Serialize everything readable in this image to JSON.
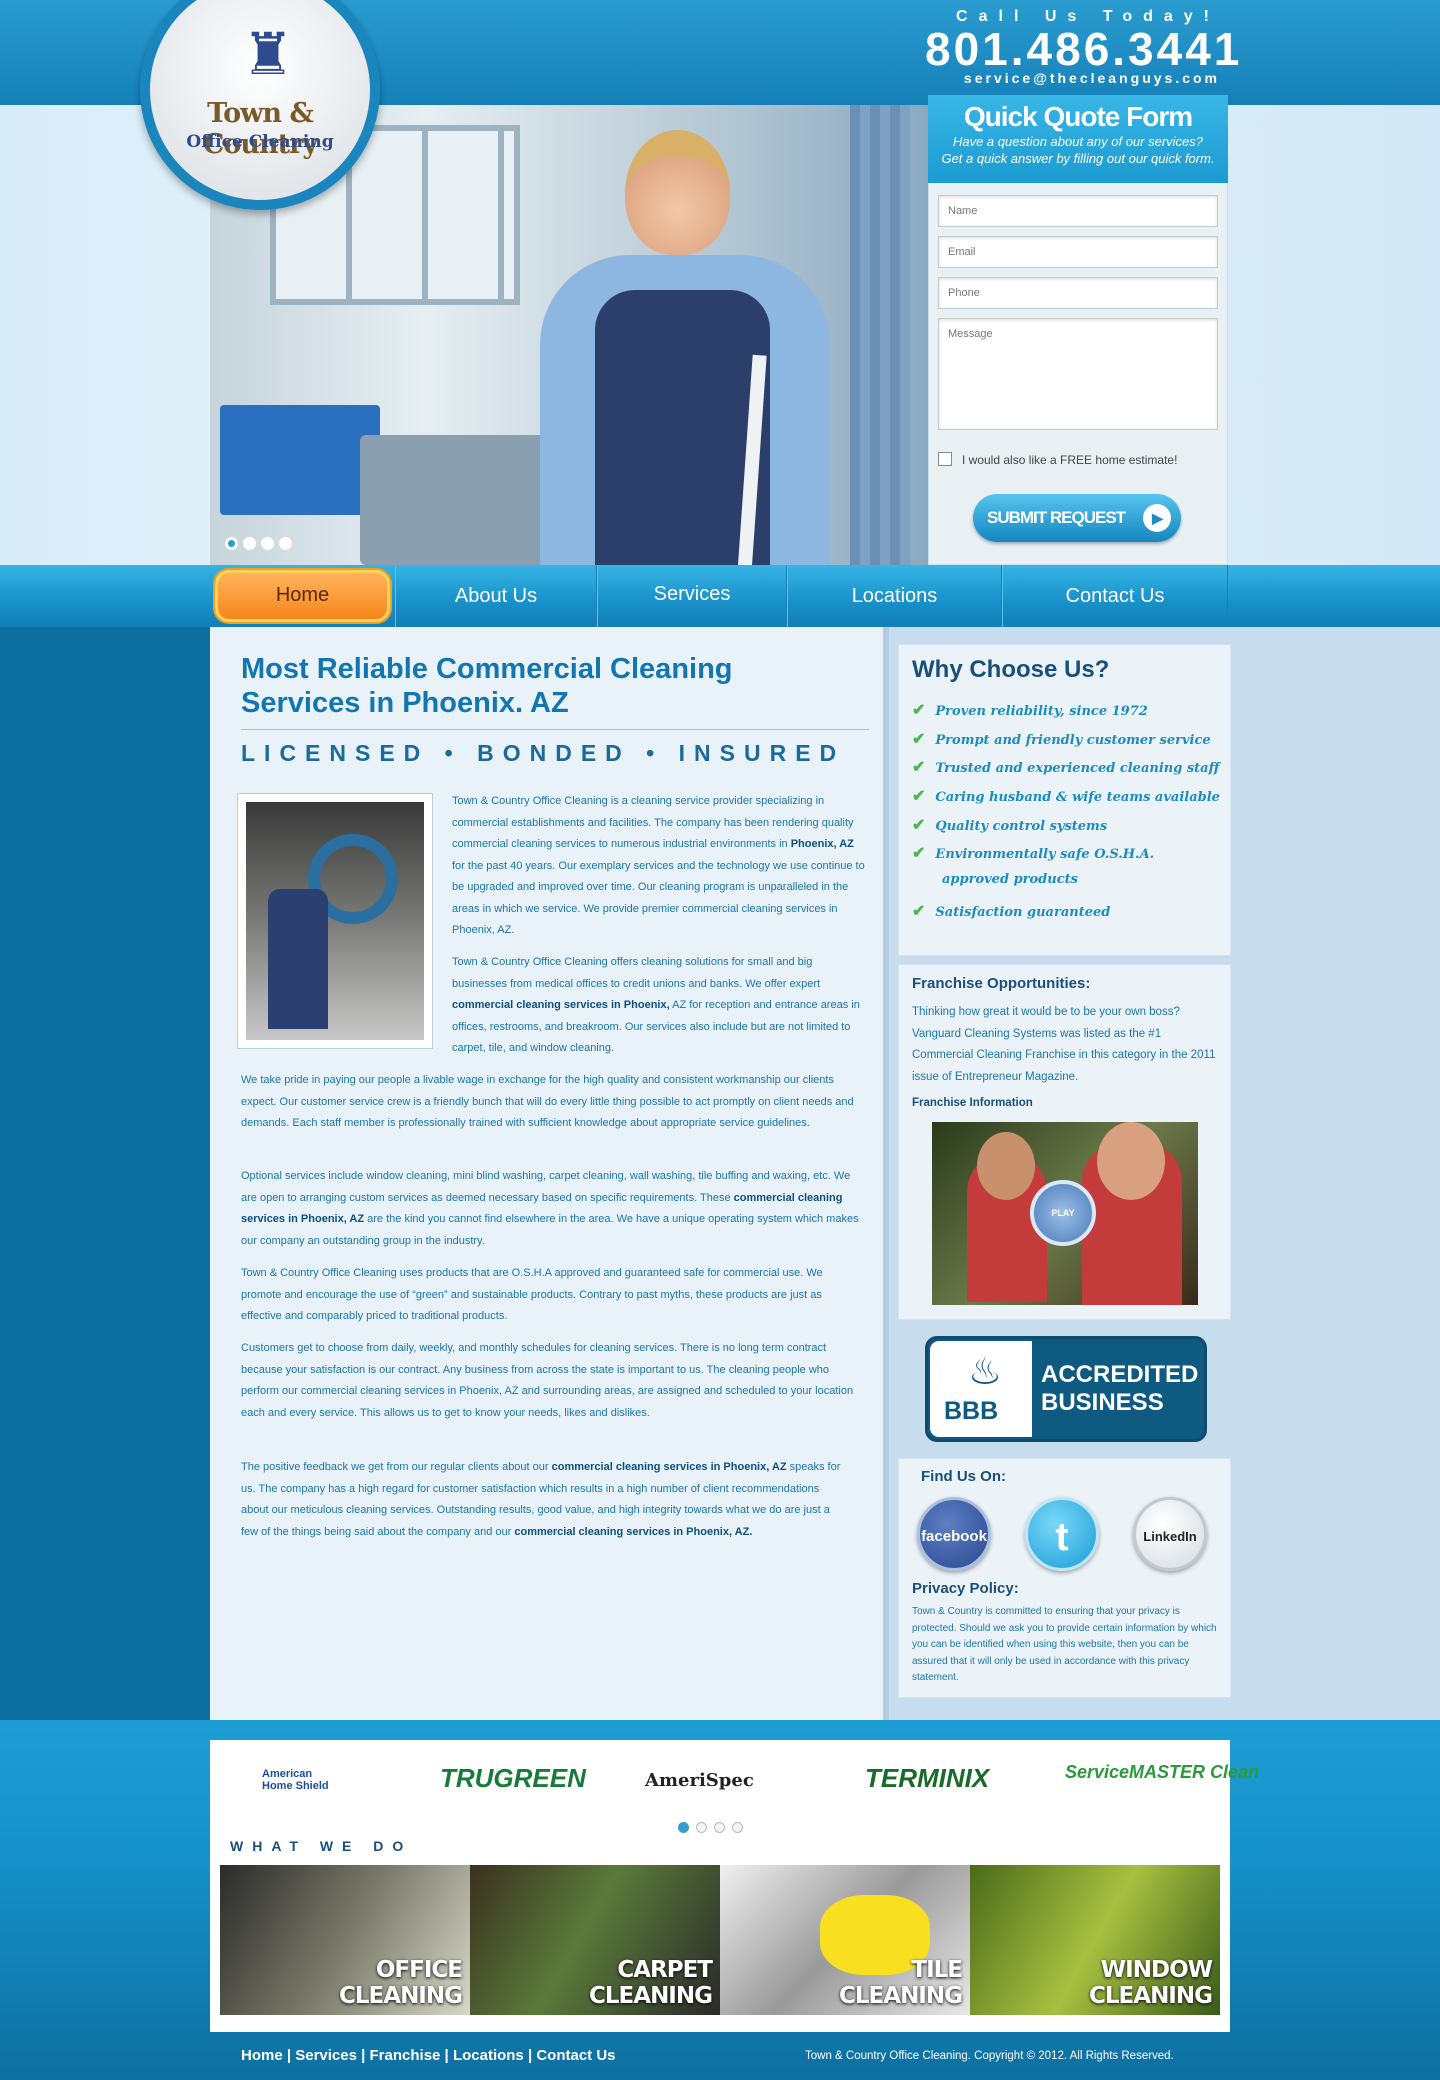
{
  "header": {
    "call_label": "Call Us Today!",
    "phone": "801.486.3441",
    "email": "service@thecleanguys.com",
    "logo_line1": "Town & Country",
    "logo_line2": "Office Cleaning"
  },
  "quote_form": {
    "title": "Quick Quote Form",
    "subtitle1": "Have a question about any of our services?",
    "subtitle2": "Get a quick answer by filling out our quick form.",
    "name_placeholder": "Name",
    "email_placeholder": "Email",
    "phone_placeholder": "Phone",
    "message_placeholder": "Message",
    "checkbox_label": "I would also like a FREE home estimate!",
    "submit_label": "SUBMIT REQUEST"
  },
  "nav": {
    "items": [
      "Home",
      "About Us",
      "Services",
      "Locations",
      "Contact Us"
    ]
  },
  "main": {
    "title": "Most Reliable Commercial Cleaning Services in Phoenix. AZ",
    "tagline": "LICENSED • BONDED • INSURED",
    "p1a": "Town & Country Office Cleaning is a cleaning service provider specializing in commercial establishments and facilities. The company has been rendering quality commercial cleaning services to numerous industrial environments in ",
    "p1b": "Phoenix, AZ",
    "p1c": " for the past 40 years. Our exemplary services and the technology we use continue to be upgraded and improved over time. Our cleaning program is unparalleled in the areas in which we service. We provide premier commercial cleaning services in Phoenix, AZ.",
    "p2a": "Town & Country Office Cleaning offers cleaning solutions for small and big businesses from medical offices to credit unions and banks. We offer expert ",
    "p2b": "commercial cleaning services in Phoenix,",
    "p2c": " AZ for reception and entrance areas in offices, restrooms, and breakroom. Our services also include but are not limited to carpet, tile, and window cleaning.",
    "p3": "We take pride in paying our people a livable wage in exchange for the high quality and consistent workmanship our clients expect. Our customer service crew is a friendly bunch that will do every little thing possible to act promptly on client needs and demands. Each staff member is professionally trained with sufficient knowledge about appropriate service guidelines.",
    "p4a": "Optional services include window cleaning, mini blind washing, carpet cleaning, wall washing, tile buffing and waxing, etc. We are open to arranging custom services as deemed necessary based on specific requirements. These ",
    "p4b": "commercial cleaning services in Phoenix, AZ",
    "p4c": " are the kind you cannot find elsewhere in the area. We have a unique operating system which makes our company an outstanding group in the industry.",
    "p5": "Town & Country Office Cleaning uses products that are O.S.H.A approved and guaranteed safe for commercial use. We promote and encourage the use of “green” and sustainable products. Contrary to past myths, these products are just as effective and comparably priced to traditional products.",
    "p6": "Customers get to choose from daily, weekly, and monthly schedules for cleaning services. There is no long term contract because your satisfaction is our contract. Any business from across the state is important to us. The cleaning people who perform our commercial cleaning services in Phoenix, AZ and surrounding areas, are assigned and scheduled to your location each and every service. This allows us to get to know your needs, likes and dislikes.",
    "p7a": "The positive feedback we get from our regular clients about our ",
    "p7b": "commercial cleaning services in Phoenix, AZ",
    "p7c": " speaks for us. The company has a high regard for customer satisfaction which results in a high number of client recommendations about our meticulous cleaning services. Outstanding results, good value, and high integrity towards what we do are just a few of the things being said about the company and our ",
    "p7d": "commercial cleaning services in Phoenix, AZ."
  },
  "why": {
    "title": "Why Choose Us?",
    "items": [
      "Proven reliability, since 1972",
      "Prompt and friendly customer service",
      "Trusted and experienced cleaning staff",
      "Caring husband & wife teams available",
      "Quality control systems",
      "Environmentally safe O.S.H.A.",
      "approved products",
      "Satisfaction guaranteed"
    ]
  },
  "franchise": {
    "title": "Franchise Opportunities:",
    "text": "Thinking how great it would be to be your own boss? Vanguard Cleaning Systems was listed as the #1 Commercial Cleaning Franchise in this category in the 2011 issue of Entrepreneur Magazine.",
    "info_label": "Franchise Information",
    "play_label": "PLAY"
  },
  "bbb": {
    "line1": "ACCREDITED",
    "line2": "BUSINESS",
    "logo": "BBB"
  },
  "social": {
    "title": "Find Us On:",
    "facebook": "facebook",
    "twitter": "t",
    "linkedin": "LinkedIn"
  },
  "privacy": {
    "title": "Privacy Policy:",
    "text": "Town & Country is committed to ensuring that your privacy is protected. Should we ask you to provide certain information by which you can be identified when using this website, then you can be assured that it will only be used in accordance with this privacy statement."
  },
  "brands": {
    "ahs1": "American",
    "ahs2": "Home Shield",
    "trugreen": "TRUGREEN",
    "amerispec": "AmeriSpec",
    "terminix": "TERMINIX",
    "servicemaster": "ServiceMASTER Clean"
  },
  "what_we_do": {
    "title": "WHAT WE DO",
    "tiles": [
      {
        "l1": "OFFICE",
        "l2": "CLEANING"
      },
      {
        "l1": "CARPET",
        "l2": "CLEANING"
      },
      {
        "l1": "TILE",
        "l2": "CLEANING"
      },
      {
        "l1": "WINDOW",
        "l2": "CLEANING"
      }
    ]
  },
  "footer": {
    "links": [
      "Home",
      "Services",
      "Franchise",
      "Locations",
      "Contact Us"
    ],
    "copyright": "Town & Country Office Cleaning. Copyright © 2012. All Rights Reserved."
  }
}
